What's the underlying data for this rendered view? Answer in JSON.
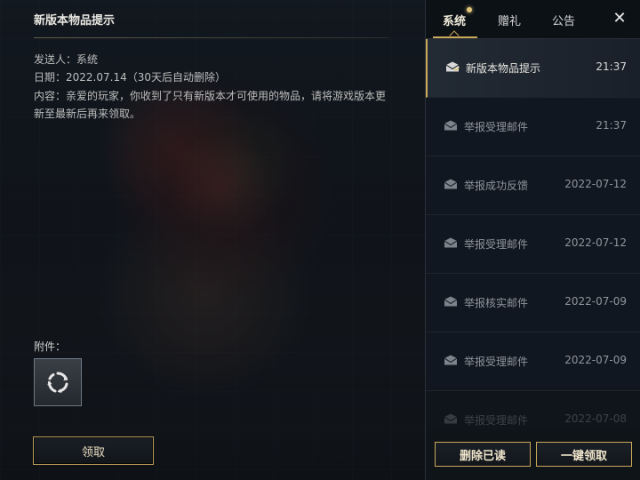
{
  "mail": {
    "title": "新版本物品提示",
    "sender": "发送人：系统",
    "date": "日期：2022.07.14（30天后自动删除）",
    "content": "内容：亲爱的玩家，你收到了只有新版本才可使用的物品，请将游戏版本更新至最新后再来领取。",
    "attachments_label": "附件：",
    "claim_label": "领取"
  },
  "tabs": [
    {
      "label": "系统",
      "active": true,
      "has_badge": true
    },
    {
      "label": "赠礼",
      "active": false
    },
    {
      "label": "公告",
      "active": false
    }
  ],
  "close_icon": "close-icon",
  "mail_list": [
    {
      "title": "新版本物品提示",
      "time": "21:37",
      "active": true
    },
    {
      "title": "举报受理邮件",
      "time": "21:37"
    },
    {
      "title": "举报成功反馈",
      "time": "2022-07-12"
    },
    {
      "title": "举报受理邮件",
      "time": "2022-07-12"
    },
    {
      "title": "举报核实邮件",
      "time": "2022-07-09"
    },
    {
      "title": "举报受理邮件",
      "time": "2022-07-09"
    },
    {
      "title": "举报受理邮件",
      "time": "2022-07-08"
    }
  ],
  "actions": {
    "delete_read": "删除已读",
    "claim_all": "一键领取"
  },
  "colors": {
    "accent_gold": "#c9a85b",
    "panel_bg": "#0f1419"
  }
}
